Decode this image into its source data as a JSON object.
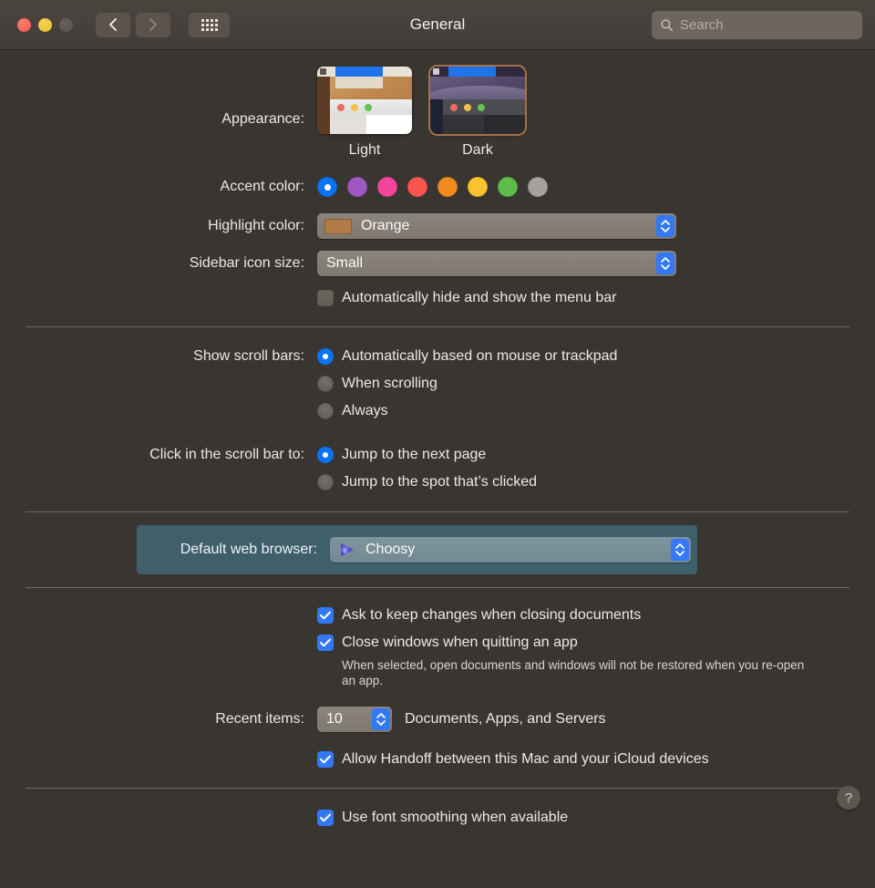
{
  "window": {
    "title": "General",
    "traffic_lights": [
      "close",
      "minimize",
      "zoom"
    ],
    "nav": {
      "back": "back-chevron",
      "forward": "forward-chevron",
      "grid": "show-all-grid"
    },
    "search": {
      "placeholder": "Search",
      "value": ""
    }
  },
  "appearance": {
    "label": "Appearance:",
    "options": [
      {
        "name": "Light",
        "selected": false
      },
      {
        "name": "Dark",
        "selected": true
      }
    ]
  },
  "accent_color": {
    "label": "Accent color:",
    "selected_index": 0,
    "colors": [
      {
        "name": "Blue",
        "hex": "#0a74f0",
        "selected": true
      },
      {
        "name": "Purple",
        "hex": "#a057c0",
        "selected": false
      },
      {
        "name": "Pink",
        "hex": "#f2459b",
        "selected": false
      },
      {
        "name": "Red",
        "hex": "#f65murky",
        "selected": false
      },
      {
        "name": "Orange",
        "hex": "#f08a1e",
        "selected": false
      },
      {
        "name": "Yellow",
        "hex": "#f8c230",
        "selected": false
      },
      {
        "name": "Green",
        "hex": "#5dbd4b",
        "selected": false
      },
      {
        "name": "Graphite",
        "hex": "#a5a19c",
        "selected": false
      }
    ]
  },
  "highlight_color": {
    "label": "Highlight color:",
    "value": "Orange",
    "swatch_hex": "#b07b47"
  },
  "sidebar_icon_size": {
    "label": "Sidebar icon size:",
    "value": "Small"
  },
  "menu_bar": {
    "auto_hide_label": "Automatically hide and show the menu bar",
    "auto_hide_checked": false
  },
  "scroll_bars": {
    "label": "Show scroll bars:",
    "options": [
      {
        "label": "Automatically based on mouse or trackpad",
        "selected": true
      },
      {
        "label": "When scrolling",
        "selected": false
      },
      {
        "label": "Always",
        "selected": false
      }
    ]
  },
  "scroll_click": {
    "label": "Click in the scroll bar to:",
    "options": [
      {
        "label": "Jump to the next page",
        "selected": true
      },
      {
        "label": "Jump to the spot that’s clicked",
        "selected": false
      }
    ]
  },
  "default_browser": {
    "label": "Default web browser:",
    "value": "Choosy",
    "icon": "choosy-app-icon",
    "highlight_hex": "#3f5f6b"
  },
  "documents": {
    "ask_keep_changes": {
      "label": "Ask to keep changes when closing documents",
      "checked": true
    },
    "close_windows": {
      "label": "Close windows when quitting an app",
      "checked": true
    },
    "close_windows_hint": "When selected, open documents and windows will not be restored when you re-open an app."
  },
  "recent_items": {
    "label": "Recent items:",
    "value": "10",
    "suffix": "Documents, Apps, and Servers"
  },
  "handoff": {
    "label": "Allow Handoff between this Mac and your iCloud devices",
    "checked": true
  },
  "font_smoothing": {
    "label": "Use font smoothing when available",
    "checked": true
  },
  "help": {
    "glyph": "?"
  }
}
